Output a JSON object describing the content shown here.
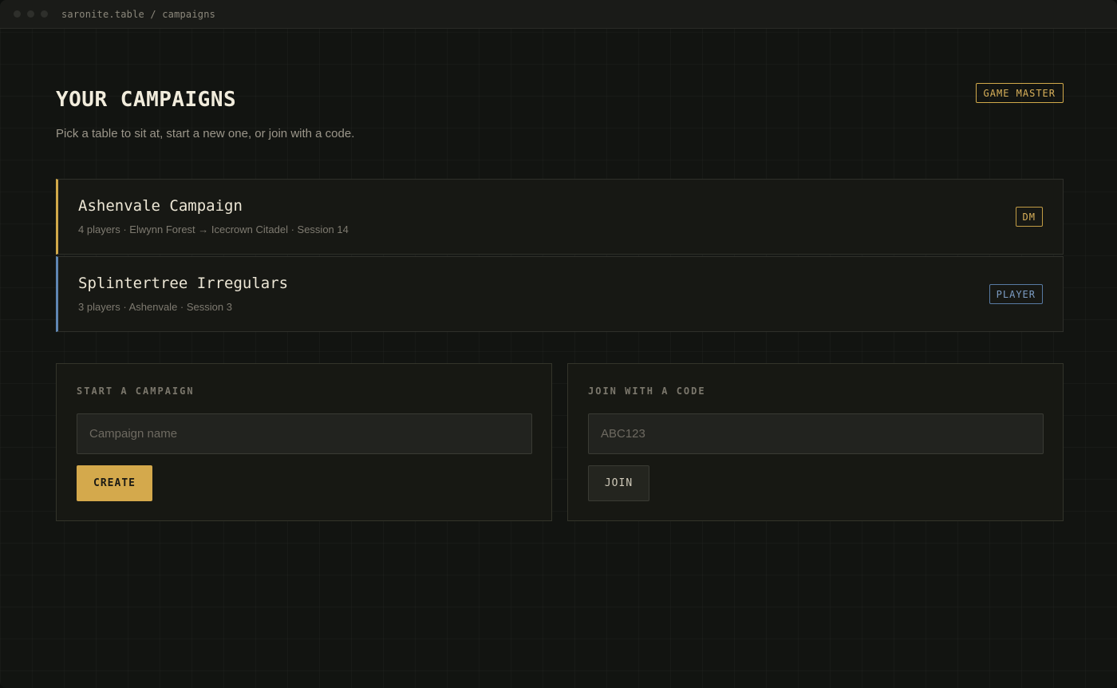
{
  "app": {
    "breadcrumb": "saronite.table / campaigns"
  },
  "header": {
    "title": "YOUR CAMPAIGNS",
    "subtitle": "Pick a table to sit at, start a new one, or join with a code.",
    "role_badge": "GAME MASTER"
  },
  "campaigns": [
    {
      "name": "Ashenvale Campaign",
      "meta": "4 players · Elwynn Forest → Icecrown Citadel · Session 14",
      "role": "DM",
      "accent": "#d1a94a"
    },
    {
      "name": "Splintertree Irregulars",
      "meta": "3 players · Ashenvale · Session 3",
      "role": "PLAYER",
      "accent": "#5f86b3"
    }
  ],
  "start_panel": {
    "heading": "START A CAMPAIGN",
    "placeholder": "Campaign name",
    "button": "CREATE"
  },
  "join_panel": {
    "heading": "JOIN WITH A CODE",
    "placeholder": "ABC123",
    "button": "JOIN"
  },
  "colors": {
    "accent_gold": "#d4a94c",
    "accent_blue": "#5f86b3",
    "background": "#121411"
  }
}
